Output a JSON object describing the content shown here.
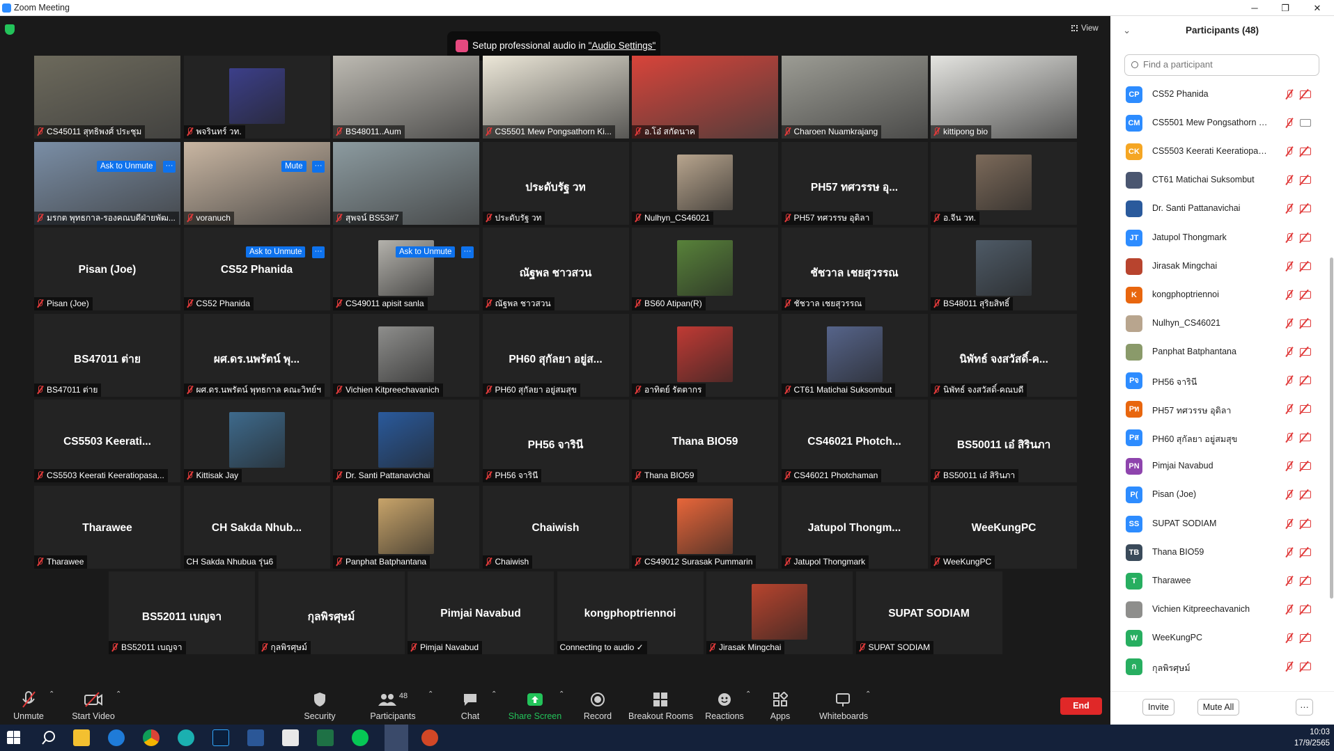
{
  "window": {
    "title": "Zoom Meeting",
    "minimize": "─",
    "maximize": "❐",
    "close": "✕"
  },
  "meeting": {
    "view_label": "View",
    "audio_banner": {
      "prefix": "Setup professional audio in ",
      "link": "\"Audio Settings\""
    },
    "hover_labels": {
      "ask_to_unmute": "Ask to Unmute",
      "mute": "Mute",
      "more": "···"
    }
  },
  "tiles": [
    {
      "name": "CS45011 สุทธิพงศ์ ประชุม",
      "big": "",
      "kind": "video",
      "color": "#6d6a5c"
    },
    {
      "name": "พจรินทร์ วท.",
      "big": "",
      "kind": "photo",
      "color": "#3c3f8a"
    },
    {
      "name": "BS48011..Aum",
      "big": "",
      "kind": "video",
      "color": "#bdbab2"
    },
    {
      "name": "CS5501 Mew Pongsathorn Ki...",
      "big": "",
      "kind": "video",
      "color": "#ece7d8"
    },
    {
      "name": "อ.โอ๋ สกัดนาค",
      "big": "",
      "kind": "video",
      "color": "#d8443a"
    },
    {
      "name": "Charoen Nuamkrajang",
      "big": "",
      "kind": "video",
      "color": "#9c9c94",
      "highlight": true
    },
    {
      "name": "kittipong bio",
      "big": "",
      "kind": "video",
      "color": "#e4e4e0"
    },
    {
      "name": "มรกต พุทธกาล-รองคณบดีฝ่ายพัฒ...",
      "big": "",
      "kind": "video",
      "color": "#7a8ea6"
    },
    {
      "name": "voranuch",
      "big": "",
      "kind": "video",
      "color": "#c9b6a2"
    },
    {
      "name": "สุพจน์ BS53#7",
      "big": "",
      "kind": "video",
      "color": "#8c9ba0"
    },
    {
      "name": "ประดับรัฐ วท",
      "big": "ประดับรัฐ วท",
      "kind": "name"
    },
    {
      "name": "Nulhyn_CS46021",
      "big": "",
      "kind": "photo",
      "color": "#b8a58e"
    },
    {
      "name": "PH57 ทศวรรษ อุดิลา",
      "big": "PH57 ทศวรรษ อุ...",
      "kind": "name"
    },
    {
      "name": "อ.จีน วท.",
      "big": "",
      "kind": "photo",
      "color": "#7c6a5a"
    },
    {
      "name": "Pisan (Joe)",
      "big": "Pisan (Joe)",
      "kind": "name"
    },
    {
      "name": "CS52 Phanida",
      "big": "CS52 Phanida",
      "kind": "name"
    },
    {
      "name": "CS49011 apisit sanla",
      "big": "",
      "kind": "photo",
      "color": "#b4b2ac"
    },
    {
      "name": "ณัฐพล ชาวสวน",
      "big": "ณัฐพล ชาวสวน",
      "kind": "name"
    },
    {
      "name": "BS60 Atipan(R)",
      "big": "",
      "kind": "photo",
      "color": "#58823a"
    },
    {
      "name": "ชัชวาล เชยสุวรรณ",
      "big": "ชัชวาล เชยสุวรรณ",
      "kind": "name"
    },
    {
      "name": "BS48011 สุริยสิทธิ์",
      "big": "",
      "kind": "photo",
      "color": "#4e5a66"
    },
    {
      "name": "BS47011 ต่าย",
      "big": "BS47011 ต่าย",
      "kind": "name"
    },
    {
      "name": "ผศ.ดร.นพรัตน์ พุทธกาล คณะวิทย์ฯ",
      "big": "ผศ.ดร.นพรัตน์ พุ...",
      "kind": "name"
    },
    {
      "name": "Vichien Kitpreechavanich",
      "big": "",
      "kind": "photo",
      "color": "#8e8e8c"
    },
    {
      "name": "PH60 สุกัลยา อยู่สมสุข",
      "big": "PH60 สุกัลยา อยู่ส...",
      "kind": "name"
    },
    {
      "name": "อาทิตย์ รัตตากร",
      "big": "",
      "kind": "photo",
      "color": "#c03a34"
    },
    {
      "name": "CT61 Matichai Suksombut",
      "big": "",
      "kind": "photo",
      "color": "#56648a"
    },
    {
      "name": "นิพัทธ์ จงสวัสดิ์-คณบดี",
      "big": "นิพัทธ์ จงสวัสดิ์-ค...",
      "kind": "name"
    },
    {
      "name": "CS5503 Keerati Keeratiopasa...",
      "big": "CS5503 Keerati...",
      "kind": "name"
    },
    {
      "name": "Kittisak Jay",
      "big": "",
      "kind": "photo",
      "color": "#3e6a8c"
    },
    {
      "name": "Dr. Santi Pattanavichai",
      "big": "",
      "kind": "photo",
      "color": "#2a5a9c"
    },
    {
      "name": "PH56 จารินี",
      "big": "PH56 จารินี",
      "kind": "name"
    },
    {
      "name": "Thana BIO59",
      "big": "Thana BIO59",
      "kind": "name"
    },
    {
      "name": "CS46021 Photchaman",
      "big": "CS46021 Photch...",
      "kind": "name"
    },
    {
      "name": "BS50011 เอ๋ สิรินภา",
      "big": "BS50011 เอ๋ สิรินภา",
      "kind": "name"
    },
    {
      "name": "Tharawee",
      "big": "Tharawee",
      "kind": "name"
    },
    {
      "name": "CH Sakda Nhubua รุ่น6",
      "big": "CH Sakda Nhub...",
      "kind": "name",
      "nomic": true
    },
    {
      "name": "Panphat Batphantana",
      "big": "",
      "kind": "photo",
      "color": "#c8a46a"
    },
    {
      "name": "Chaiwish",
      "big": "Chaiwish",
      "kind": "name"
    },
    {
      "name": "CS49012 Surasak Pummarin",
      "big": "",
      "kind": "photo",
      "color": "#e8663a"
    },
    {
      "name": "Jatupol Thongmark",
      "big": "Jatupol Thongm...",
      "kind": "name"
    },
    {
      "name": "WeeKungPC",
      "big": "WeeKungPC",
      "kind": "name"
    },
    {
      "name": "BS52011 เบญจา",
      "big": "BS52011 เบญจา",
      "kind": "name"
    },
    {
      "name": "กุลพิรศุษม์",
      "big": "กุลพิรศุษม์",
      "kind": "name"
    },
    {
      "name": "Pimjai Navabud",
      "big": "Pimjai Navabud",
      "kind": "name"
    },
    {
      "name": "Connecting to audio ✓",
      "big": "kongphoptriennoi",
      "kind": "name",
      "nomic": true
    },
    {
      "name": "Jirasak Mingchai",
      "big": "",
      "kind": "photo",
      "color": "#b8442e"
    },
    {
      "name": "SUPAT SODIAM",
      "big": "SUPAT SODIAM",
      "kind": "name"
    }
  ],
  "toolbar": {
    "unmute": "Unmute",
    "start_video": "Start Video",
    "security": "Security",
    "participants": "Participants",
    "participants_count": "48",
    "chat": "Chat",
    "share_screen": "Share Screen",
    "record": "Record",
    "breakout_rooms": "Breakout Rooms",
    "reactions": "Reactions",
    "apps": "Apps",
    "whiteboards": "Whiteboards",
    "end": "End"
  },
  "panel": {
    "title": "Participants (48)",
    "search_placeholder": "Find a participant",
    "invite": "Invite",
    "mute_all": "Mute All",
    "more": "···",
    "participants": [
      {
        "initials": "CP",
        "name": "CS52 Phanida",
        "color": "#2d8cff",
        "cam_on": false
      },
      {
        "initials": "CM",
        "name": "CS5501 Mew Pongsathorn Kiat...",
        "color": "#2d8cff",
        "cam_on": true
      },
      {
        "initials": "CK",
        "name": "CS5503 Keerati Keeratiopasaw...",
        "color": "#f5a623",
        "cam_on": false
      },
      {
        "initials": "",
        "name": "CT61 Matichai Suksombut",
        "color": "#4a5670",
        "cam_on": false
      },
      {
        "initials": "",
        "name": "Dr. Santi Pattanavichai",
        "color": "#2a5a9c",
        "cam_on": false
      },
      {
        "initials": "JT",
        "name": "Jatupol Thongmark",
        "color": "#2d8cff",
        "cam_on": false
      },
      {
        "initials": "",
        "name": "Jirasak Mingchai",
        "color": "#b8442e",
        "cam_on": false
      },
      {
        "initials": "K",
        "name": "kongphoptriennoi",
        "color": "#e8660e",
        "cam_on": false
      },
      {
        "initials": "",
        "name": "Nulhyn_CS46021",
        "color": "#b8a58e",
        "cam_on": false
      },
      {
        "initials": "",
        "name": "Panphat Batphantana",
        "color": "#8a9a6a",
        "cam_on": false
      },
      {
        "initials": "Pจ",
        "name": "PH56 จารินี",
        "color": "#2d8cff",
        "cam_on": false
      },
      {
        "initials": "Pท",
        "name": "PH57 ทศวรรษ อุดิลา",
        "color": "#e8660e",
        "cam_on": false
      },
      {
        "initials": "Pส",
        "name": "PH60 สุกัลยา อยู่สมสุข",
        "color": "#2d8cff",
        "cam_on": false
      },
      {
        "initials": "PN",
        "name": "Pimjai Navabud",
        "color": "#8e44ad",
        "cam_on": false
      },
      {
        "initials": "P(",
        "name": "Pisan (Joe)",
        "color": "#2d8cff",
        "cam_on": false
      },
      {
        "initials": "SS",
        "name": "SUPAT SODIAM",
        "color": "#2d8cff",
        "cam_on": false
      },
      {
        "initials": "TB",
        "name": "Thana BIO59",
        "color": "#3a4a5a",
        "cam_on": false
      },
      {
        "initials": "T",
        "name": "Tharawee",
        "color": "#27ae60",
        "cam_on": false
      },
      {
        "initials": "",
        "name": "Vichien Kitpreechavanich",
        "color": "#8e8e8c",
        "cam_on": false
      },
      {
        "initials": "W",
        "name": "WeeKungPC",
        "color": "#27ae60",
        "cam_on": false
      },
      {
        "initials": "ก",
        "name": "กุลพิรศุษม์",
        "color": "#27ae60",
        "cam_on": false
      }
    ]
  },
  "taskbar": {
    "time": "10:03",
    "date": "17/9/2565"
  }
}
